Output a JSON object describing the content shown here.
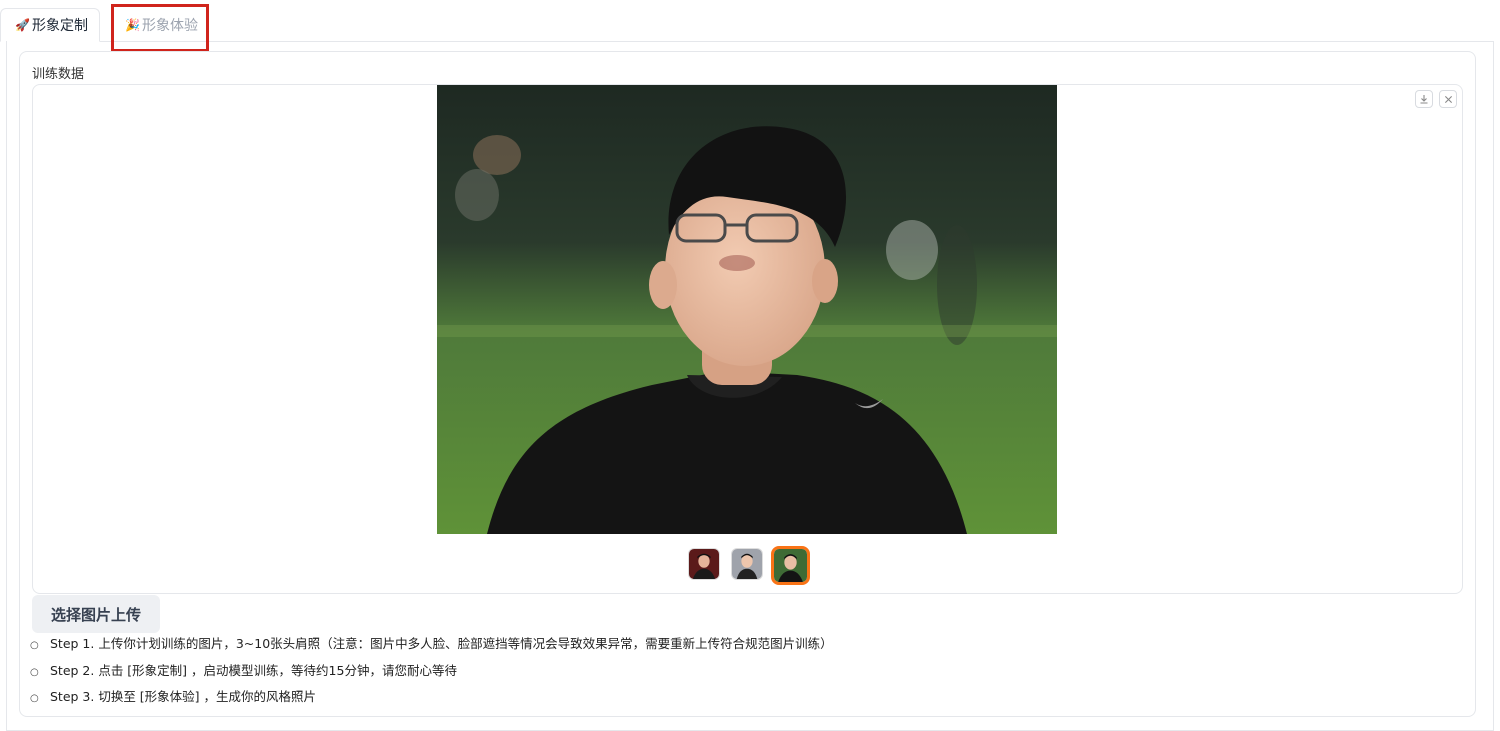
{
  "tabs": [
    {
      "icon": "🚀",
      "label": "形象定制"
    },
    {
      "icon": "🎉",
      "label": "形象体验"
    }
  ],
  "block": {
    "label": "训练数据"
  },
  "gallery": {
    "download_icon": "download-icon",
    "close_icon": "close-icon",
    "selected_index": 2,
    "thumbnail_count": 3
  },
  "upload_button": "选择图片上传",
  "steps": [
    "Step 1. 上传你计划训练的图片，3~10张头肩照（注意：图片中多人脸、脸部遮挡等情况会导致效果异常，需要重新上传符合规范图片训练）",
    "Step 2. 点击 [形象定制] ，启动模型训练，等待约15分钟，请您耐心等待",
    "Step 3. 切换至 [形象体验] ，生成你的风格照片"
  ],
  "colors": {
    "highlight": "#d0241c",
    "thumb_selected": "#f97316"
  }
}
